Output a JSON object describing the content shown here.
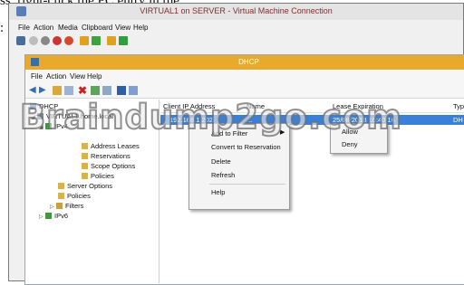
{
  "document": {
    "top_text": "ss, right-click the PC entry in the",
    "colon": ":"
  },
  "vm_window": {
    "title": "VIRTUAL1 on SERVER - Virtual Machine Connection",
    "menu": [
      "File",
      "Action",
      "Media",
      "Clipboard",
      "View",
      "Help"
    ]
  },
  "dhcp_window": {
    "title": "DHCP",
    "menu": [
      "File",
      "Action",
      "View",
      "Help"
    ],
    "tree": {
      "root": "DHCP",
      "server": "VIRTUAL1.home.local",
      "ipv4": "IPv4",
      "address_leases": "Address Leases",
      "reservations": "Reservations",
      "scope_options": "Scope Options",
      "policies_scope": "Policies",
      "server_options": "Server Options",
      "policies": "Policies",
      "filters": "Filters",
      "ipv6": "IPv6"
    },
    "list": {
      "columns": [
        "Client IP Address",
        "Name",
        "Lease Expiration",
        "Typ"
      ],
      "row": {
        "ip": "192.168.1.202",
        "name": "...",
        "lease": "25/08/2013 16:40:16",
        "type": "DH"
      }
    }
  },
  "context_menu": {
    "add_to_filter": "Add to Filter",
    "convert": "Convert to Reservation",
    "delete": "Delete",
    "refresh": "Refresh",
    "help": "Help"
  },
  "submenu": {
    "allow": "Allow",
    "deny": "Deny"
  },
  "watermark": "Braindump2go.com",
  "colors": {
    "dhcp_titlebar": "#e8a92c",
    "selection": "#3a7fd8",
    "vm_title_text": "#8b2a2a"
  }
}
